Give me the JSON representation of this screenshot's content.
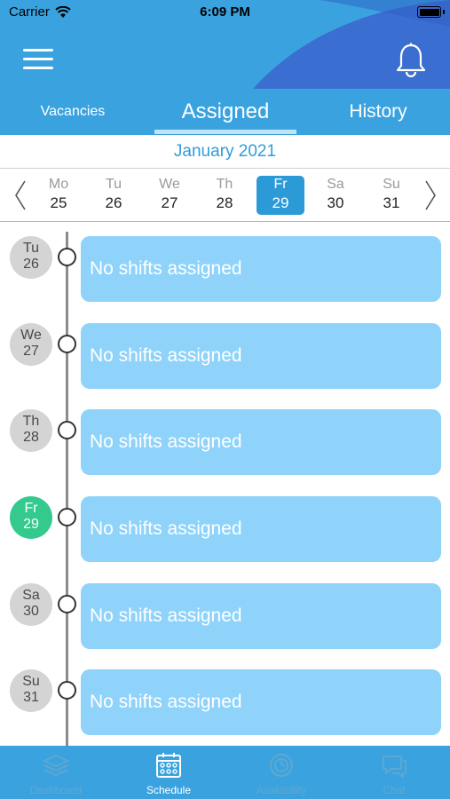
{
  "status_bar": {
    "carrier": "Carrier",
    "time": "6:09 PM"
  },
  "header": {
    "tabs": [
      {
        "label": "Vacancies",
        "active": false
      },
      {
        "label": "Assigned",
        "active": true
      },
      {
        "label": "History",
        "active": false
      }
    ]
  },
  "calendar": {
    "month": "January 2021",
    "days": [
      {
        "abbr": "Mo",
        "num": "25",
        "selected": false
      },
      {
        "abbr": "Tu",
        "num": "26",
        "selected": false
      },
      {
        "abbr": "We",
        "num": "27",
        "selected": false
      },
      {
        "abbr": "Th",
        "num": "28",
        "selected": false
      },
      {
        "abbr": "Fr",
        "num": "29",
        "selected": true
      },
      {
        "abbr": "Sa",
        "num": "30",
        "selected": false
      },
      {
        "abbr": "Su",
        "num": "31",
        "selected": false
      }
    ]
  },
  "timeline": [
    {
      "abbr": "Tu",
      "num": "26",
      "today": false,
      "text": "No shifts assigned"
    },
    {
      "abbr": "We",
      "num": "27",
      "today": false,
      "text": "No shifts assigned"
    },
    {
      "abbr": "Th",
      "num": "28",
      "today": false,
      "text": "No shifts assigned"
    },
    {
      "abbr": "Fr",
      "num": "29",
      "today": true,
      "text": "No shifts assigned"
    },
    {
      "abbr": "Sa",
      "num": "30",
      "today": false,
      "text": "No shifts assigned"
    },
    {
      "abbr": "Su",
      "num": "31",
      "today": false,
      "text": "No shifts assigned"
    }
  ],
  "bottom_nav": [
    {
      "label": "Dashboard",
      "icon": "dashboard-icon",
      "active": false
    },
    {
      "label": "Schedule",
      "icon": "calendar-icon",
      "active": true
    },
    {
      "label": "Availability",
      "icon": "availability-icon",
      "active": false
    },
    {
      "label": "Chat",
      "icon": "chat-icon",
      "active": false
    }
  ],
  "colors": {
    "header_blue": "#3aa3df",
    "wave_blue": "#3a6fd1",
    "card_blue": "#8fd3fb",
    "today_green": "#34c98d",
    "selected_day": "#2d9ad8"
  }
}
